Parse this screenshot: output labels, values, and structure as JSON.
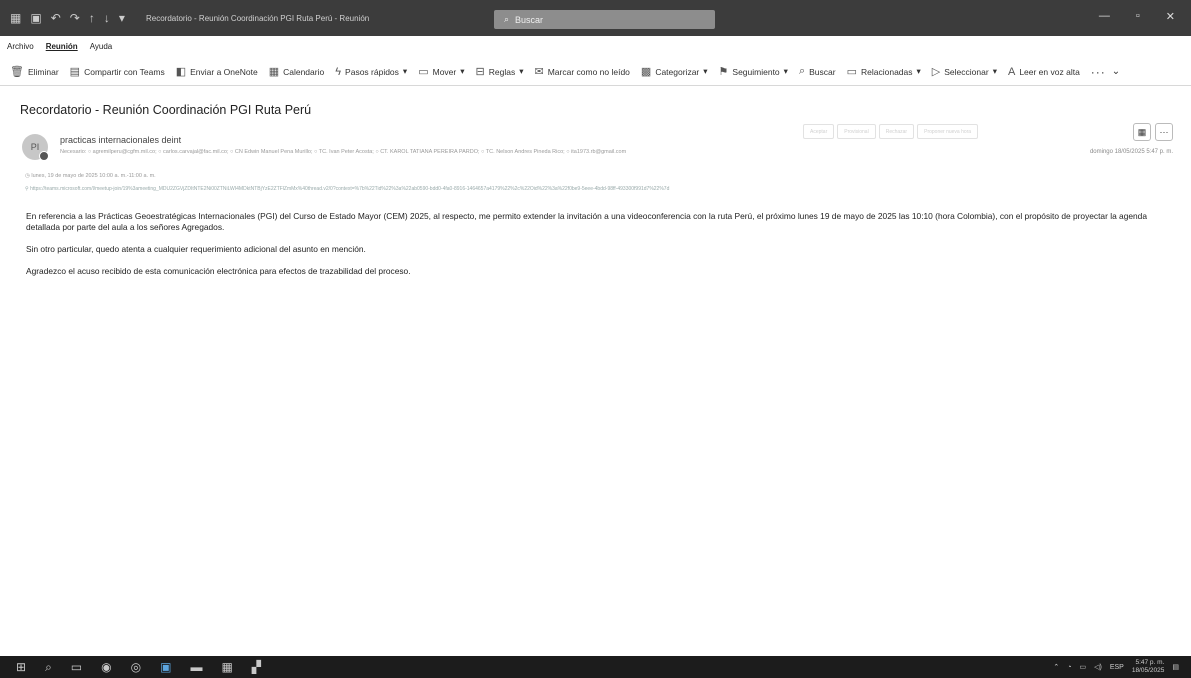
{
  "window": {
    "title": "Recordatorio - Reunión Coordinación PGI Ruta Perú - Reunión",
    "search_placeholder": "Buscar",
    "minimize_glyph": "—",
    "maximize_glyph": "▫",
    "close_glyph": "✕"
  },
  "menu": [
    "Archivo",
    "Reunión",
    "Ayuda"
  ],
  "ribbon": {
    "eliminar": "Eliminar",
    "teams": "Compartir con Teams",
    "onenote": "Enviar a OneNote",
    "calendario": "Calendario",
    "pasos": "Pasos rápidos",
    "mover": "Mover",
    "reglas": "Reglas",
    "no_leido": "Marcar como no leído",
    "categorizar": "Categorizar",
    "seguimiento": "Seguimiento",
    "buscar": "Buscar",
    "relacionadas": "Relacionadas",
    "seleccionar": "Seleccionar",
    "leer": "Leer en voz alta",
    "more": "···"
  },
  "message": {
    "subject": "Recordatorio - Reunión Coordinación PGI Ruta Perú",
    "avatar_initials": "PI",
    "sender": "practicas internacionales deint",
    "recipients": "Necesario: ○ agremilperu@cgfm.mil.co; ○ carlos.carvajal@fac.mil.co; ○ CN Edwin Manuel Pena Murillo; ○ TC. Ivan Peter Acosta; ○ CT. KAROL TATIANA PEREIRA PARDO; ○ TC. Nelson Andres Pineda Rico; ○ ita1973.rb@gmail.com",
    "date": "domingo 18/05/2025 5:47 p. m.",
    "actions": [
      "Aceptar",
      "Provisional",
      "Rechazar",
      "Proponer nueva hora"
    ],
    "meeting_time": "lunes, 19 de mayo de 2025 10:00 a. m.-11:00 a. m.",
    "meeting_link": "https://teams.microsoft.com/l/meetup-join/19%3ameeting_MDU2ZGVjZDItNTE2Ni00ZTNiLWI4MDktNTBjYzE2ZTFlZmMx%40thread.v2/0?context=%7b%22Tid%22%3a%22ab0590-bdd0-4fa0-8916-1464657a4179%22%2c%22Oid%22%3a%22f0be9-5eee-4bdd-98ff-493300f991d7%22%7d",
    "body": [
      "En referencia a las Prácticas Geoestratégicas Internacionales (PGI) del Curso de Estado Mayor (CEM) 2025, al respecto, me permito extender la invitación a una videoconferencia con la ruta Perú, el próximo lunes 19 de mayo de 2025 las 10:10 (hora Colombia), con el propósito de proyectar la agenda detallada por parte del aula a los señores Agregados.",
      "Sin otro particular, quedo atenta a cualquier requerimiento adicional del asunto en mención.",
      "Agradezco el acuso recibido de esta comunicación electrónica para efectos de trazabilidad del proceso."
    ]
  },
  "taskbar": {
    "lang": "ESP",
    "time": "5:47 p. m.",
    "date": "18/05/2025"
  }
}
